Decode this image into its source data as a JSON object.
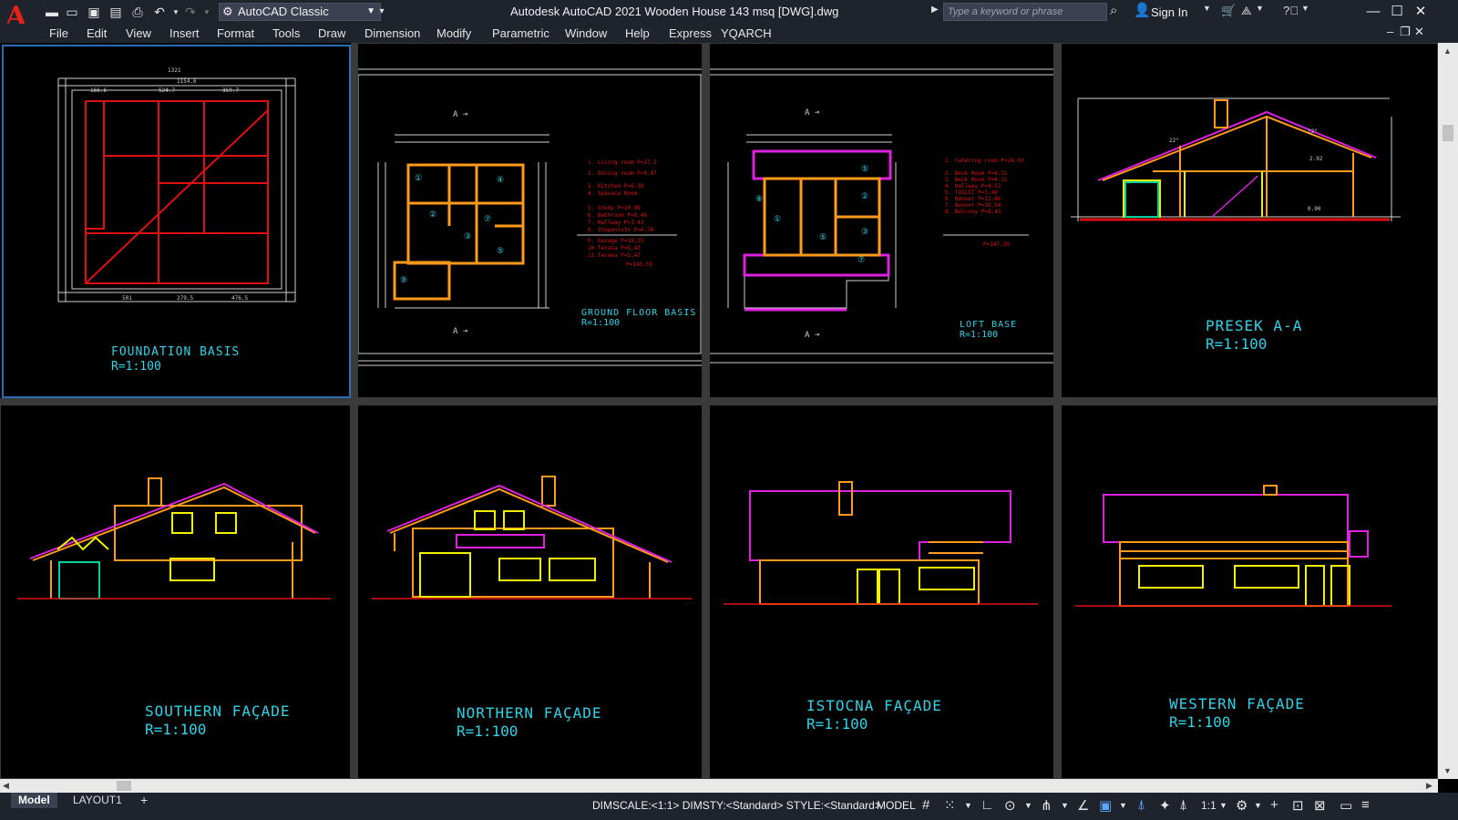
{
  "app": {
    "logo_letter": "A",
    "workspace": "AutoCAD Classic",
    "window_title": "Autodesk AutoCAD 2021    Wooden House 143 msq [DWG].dwg",
    "search_placeholder": "Type a keyword or phrase",
    "sign_in": "Sign In"
  },
  "menu": [
    "File",
    "Edit",
    "View",
    "Insert",
    "Format",
    "Tools",
    "Draw",
    "Dimension",
    "Modify",
    "Parametric",
    "Window",
    "Help",
    "Express",
    "YQARCH"
  ],
  "viewports": {
    "foundation": {
      "title": "FOUNDATION BASIS",
      "scale": "R=1:100"
    },
    "ground": {
      "title": "GROUND FLOOR BASIS",
      "scale": "R=1:100"
    },
    "loft": {
      "title": "LOFT BASE",
      "scale": "R=1:100"
    },
    "presek": {
      "title": "PRESEK A-A",
      "scale": "R=1:100"
    },
    "southern": {
      "title": "SOUTHERN FAÇADE",
      "scale": "R=1:100"
    },
    "northern": {
      "title": "NORTHERN FAÇADE",
      "scale": "R=1:100"
    },
    "istocna": {
      "title": "ISTOCNA FAÇADE",
      "scale": "R=1:100"
    },
    "western": {
      "title": "WESTERN FAÇADE",
      "scale": "R=1:100"
    }
  },
  "status": {
    "tabs": [
      "Model",
      "LAYOUT1"
    ],
    "add_tab": "+",
    "vars": "DIMSCALE:<1:1> DIMSTY:<Standard> STYLE:<Standard>",
    "space": "MODEL",
    "scale": "1:1"
  },
  "colors": {
    "title_text": "#2ed3e8",
    "walls": "#ff9a1a",
    "roof": "#e020e0",
    "foundation": "#e01010",
    "windows": "#f0f000",
    "active_viewport": "#2a6db4"
  }
}
